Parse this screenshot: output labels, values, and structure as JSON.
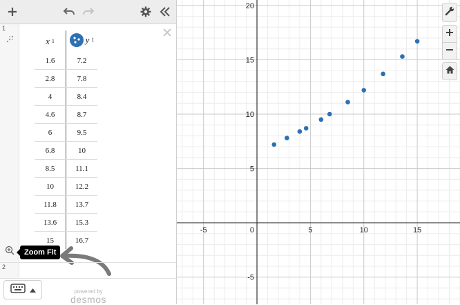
{
  "expressions": [
    {
      "index": "1",
      "table": {
        "columns": [
          {
            "name": "x",
            "sub": "1"
          },
          {
            "name": "y",
            "sub": "1"
          }
        ],
        "rows": [
          [
            "1.6",
            "7.2"
          ],
          [
            "2.8",
            "7.8"
          ],
          [
            "4",
            "8.4"
          ],
          [
            "4.6",
            "8.7"
          ],
          [
            "6",
            "9.5"
          ],
          [
            "6.8",
            "10"
          ],
          [
            "8.5",
            "11.1"
          ],
          [
            "10",
            "12.2"
          ],
          [
            "11.8",
            "13.7"
          ],
          [
            "13.6",
            "15.3"
          ],
          [
            "15",
            "16.7"
          ]
        ]
      }
    },
    {
      "index": "2"
    }
  ],
  "tooltip": {
    "text": "Zoom Fit"
  },
  "footer": {
    "powered_by": "powered by",
    "brand": "desmos"
  },
  "graph": {
    "x_range": [
      -7.5,
      19
    ],
    "y_range": [
      -7.5,
      20.5
    ],
    "x_tick_labels": [
      "-5",
      "0",
      "5",
      "10",
      "15"
    ],
    "y_tick_labels": [
      "20",
      "15",
      "10",
      "5",
      "-5"
    ],
    "point_color": "#2d70b3",
    "points": [
      [
        1.6,
        7.2
      ],
      [
        2.8,
        7.8
      ],
      [
        4,
        8.4
      ],
      [
        4.6,
        8.7
      ],
      [
        6,
        9.5
      ],
      [
        6.8,
        10
      ],
      [
        8.5,
        11.1
      ],
      [
        10,
        12.2
      ],
      [
        11.8,
        13.7
      ],
      [
        13.6,
        15.3
      ],
      [
        15,
        16.7
      ]
    ]
  },
  "colors": {
    "accent": "#2d70b3",
    "toolbar_bg": "#ededed"
  },
  "icons": [
    "add-icon",
    "undo-icon",
    "redo-icon",
    "settings-gear-icon",
    "collapse-double-chevron-icon",
    "wrench-icon",
    "zoom-in-icon",
    "zoom-out-icon",
    "home-icon",
    "zoom-fit-icon",
    "keyboard-icon",
    "caret-up-icon",
    "close-icon",
    "table-drag-icon"
  ]
}
